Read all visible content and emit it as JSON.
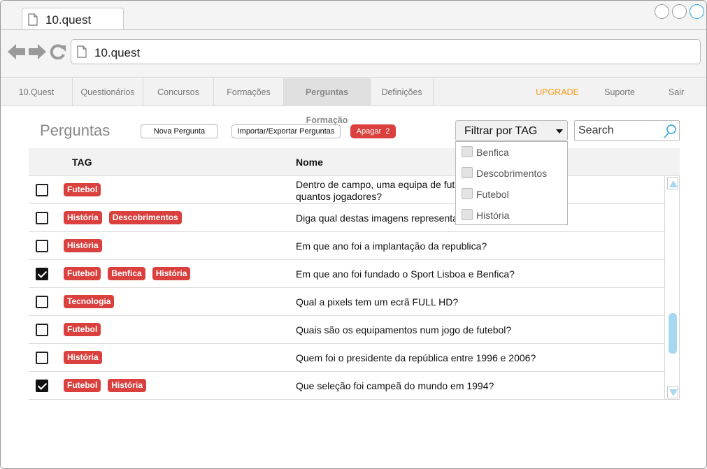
{
  "browser": {
    "tab_title": "10.quest",
    "address": "10.quest"
  },
  "menu": {
    "items": [
      {
        "label": "10.Quest"
      },
      {
        "label": "Questionários"
      },
      {
        "label": "Concursos"
      },
      {
        "label": "Formações"
      },
      {
        "label": "Perguntas Formação",
        "active": true
      },
      {
        "label": "Definições"
      }
    ],
    "upgrade": "UPGRADE",
    "support": "Suporte",
    "logout": "Sair"
  },
  "toolbar": {
    "title": "Perguntas",
    "new_question": "Nova Pergunta",
    "import_export": "Importar/Exportar Perguntas",
    "delete_label": "Apagar",
    "delete_count": "2"
  },
  "filter": {
    "label": "Filtrar por TAG",
    "options": [
      "Benfica",
      "Descobrimentos",
      "Futebol",
      "História"
    ]
  },
  "search": {
    "placeholder": "Search"
  },
  "table": {
    "headers": {
      "tag": "TAG",
      "name": "Nome"
    },
    "rows": [
      {
        "checked": false,
        "tags": [
          "Futebol"
        ],
        "name": "Dentro de campo, uma equipa de futebol tem quantos jogadores?"
      },
      {
        "checked": false,
        "tags": [
          "História",
          "Descobrimentos"
        ],
        "name": "Diga qual destas imagens representa..."
      },
      {
        "checked": false,
        "tags": [
          "História"
        ],
        "name": "Em que ano foi a implantação da republica?"
      },
      {
        "checked": true,
        "tags": [
          "Futebol",
          "Benfica",
          "História"
        ],
        "name": "Em que ano foi fundado o Sport Lisboa e Benfica?"
      },
      {
        "checked": false,
        "tags": [
          "Tecnologia"
        ],
        "name": "Qual a pixels tem um ecrã FULL HD?"
      },
      {
        "checked": false,
        "tags": [
          "Futebol"
        ],
        "name": "Quais são os equipamentos num jogo de futebol?"
      },
      {
        "checked": false,
        "tags": [
          "História"
        ],
        "name": "Quem foi o presidente da república entre 1996 e 2006?"
      },
      {
        "checked": true,
        "tags": [
          "Futebol",
          "História"
        ],
        "name": "Que seleção foi campeã do mundo em 1994?"
      }
    ]
  },
  "colors": {
    "tag": "#d9403e",
    "upgrade": "#f39c19",
    "scroll": "#a7d8f2"
  }
}
